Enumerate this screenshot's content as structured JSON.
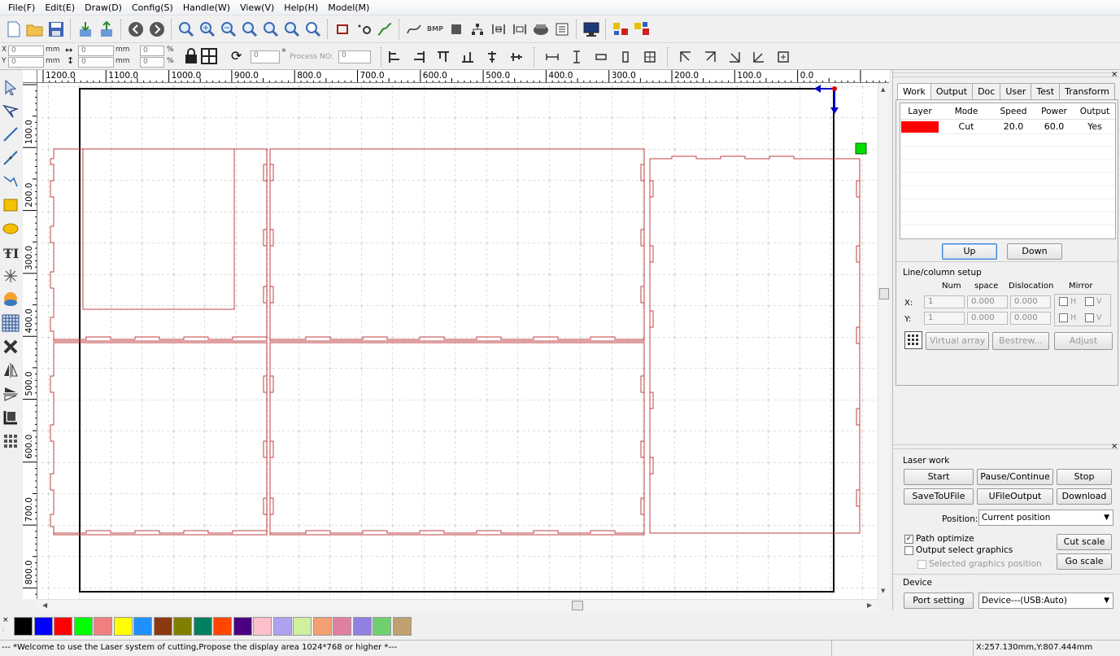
{
  "menu": [
    "File(F)",
    "Edit(E)",
    "Draw(D)",
    "Config(S)",
    "Handle(W)",
    "View(V)",
    "Help(H)",
    "Model(M)"
  ],
  "toolbar2": {
    "x_label": "X",
    "y_label": "Y",
    "x_pos": "0",
    "y_pos": "0",
    "unit": "mm",
    "x_size": "0",
    "y_size": "0",
    "x_pct": "0",
    "y_pct": "0",
    "pct": "%",
    "rotate_value": "0",
    "degree": "°",
    "process_no_label": "Process NO:",
    "process_no": "0"
  },
  "ruler": {
    "top": [
      "1200.0",
      "1100.0",
      "1000.0",
      "900.0",
      "800.0",
      "700.0",
      "600.0",
      "500.0",
      "400.0",
      "300.0",
      "200.0",
      "100.0",
      "0.0"
    ],
    "left": [
      "100.0",
      "200.0",
      "300.0",
      "400.0",
      "500.0",
      "600.0",
      "700.0",
      "800.0"
    ]
  },
  "right_panel": {
    "tabs": [
      "Work",
      "Output",
      "Doc",
      "User",
      "Test",
      "Transform"
    ],
    "layer_table": {
      "headers": [
        "Layer",
        "Mode",
        "Speed",
        "Power",
        "Output"
      ],
      "rows": [
        {
          "color": "#ff0000",
          "mode": "Cut",
          "speed": "20.0",
          "power": "60.0",
          "output": "Yes"
        }
      ]
    },
    "up": "Up",
    "down": "Down",
    "line_column_setup": "Line/column setup",
    "col_num": "Num",
    "col_space": "space",
    "col_dislocation": "Dislocation",
    "col_mirror": "Mirror",
    "x_label": "X:",
    "y_label": "Y:",
    "x_num": "1",
    "x_space": "0.000",
    "x_disl": "0.000",
    "y_num": "1",
    "y_space": "0.000",
    "y_disl": "0.000",
    "h": "H",
    "v": "V",
    "virtual_array": "Virtual array",
    "bestrew": "Bestrew...",
    "adjust": "Adjust",
    "laser_work": "Laser work",
    "start": "Start",
    "pause": "Pause/Continue",
    "stop": "Stop",
    "save_to_ufile": "SaveToUFile",
    "ufile_output": "UFileOutput",
    "download": "Download",
    "position_label": "Position:",
    "position_value": "Current position",
    "path_optimize": "Path optimize",
    "output_select": "Output select graphics",
    "selected_position": "Selected graphics position",
    "cut_scale": "Cut scale",
    "go_scale": "Go scale",
    "device_label": "Device",
    "port_setting": "Port setting",
    "device_value": "Device---(USB:Auto)"
  },
  "palette": [
    "#000000",
    "#0000ff",
    "#ff0000",
    "#00ff00",
    "#f08080",
    "#ffff00",
    "#1e90ff",
    "#8b3a10",
    "#808000",
    "#008060",
    "#ff4500",
    "#4b0082",
    "#ffc0cb",
    "#b0a0f0",
    "#d0f0a0",
    "#f4a070",
    "#e080a0",
    "#9080e0",
    "#70d070",
    "#c0a070"
  ],
  "status": {
    "message": "--- *Welcome to use the Laser system of cutting,Propose the display area 1024*768 or higher *---",
    "coords": "X:257.130mm,Y:807.444mm"
  },
  "colors": {
    "accent_cut": "#ff0000",
    "outline": "#c04040",
    "origin_arrow": "#0000cc",
    "laser_head": "#00dd00"
  }
}
